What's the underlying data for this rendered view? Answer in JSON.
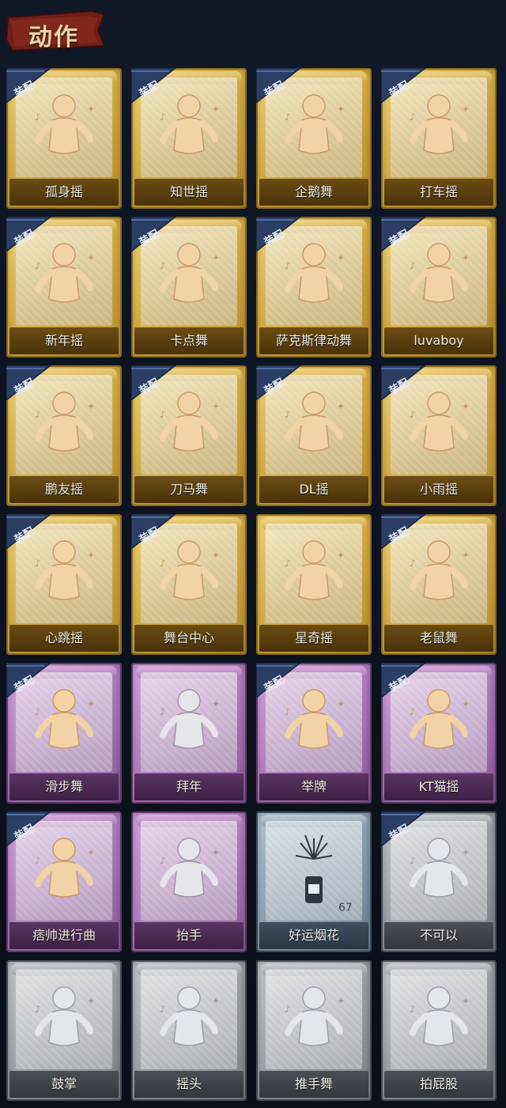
{
  "header": {
    "title": "动作"
  },
  "badge_label": "装配",
  "cards": [
    {
      "label": "孤身摇",
      "tier": "gold",
      "equipped": true,
      "count": ""
    },
    {
      "label": "知世摇",
      "tier": "gold",
      "equipped": true,
      "count": ""
    },
    {
      "label": "企鹅舞",
      "tier": "gold",
      "equipped": true,
      "count": ""
    },
    {
      "label": "打车摇",
      "tier": "gold",
      "equipped": true,
      "count": ""
    },
    {
      "label": "新年摇",
      "tier": "gold",
      "equipped": true,
      "count": ""
    },
    {
      "label": "卡点舞",
      "tier": "gold",
      "equipped": true,
      "count": ""
    },
    {
      "label": "萨克斯律动舞",
      "tier": "gold",
      "equipped": true,
      "count": ""
    },
    {
      "label": "luvaboy",
      "tier": "gold",
      "equipped": true,
      "count": ""
    },
    {
      "label": "鹏友摇",
      "tier": "gold",
      "equipped": true,
      "count": ""
    },
    {
      "label": "刀马舞",
      "tier": "gold",
      "equipped": true,
      "count": ""
    },
    {
      "label": "DL摇",
      "tier": "gold",
      "equipped": true,
      "count": ""
    },
    {
      "label": "小雨摇",
      "tier": "gold",
      "equipped": true,
      "count": ""
    },
    {
      "label": "心跳摇",
      "tier": "gold",
      "equipped": true,
      "count": ""
    },
    {
      "label": "舞台中心",
      "tier": "gold",
      "equipped": true,
      "count": ""
    },
    {
      "label": "星奇摇",
      "tier": "gold",
      "equipped": false,
      "count": ""
    },
    {
      "label": "老鼠舞",
      "tier": "gold",
      "equipped": true,
      "count": ""
    },
    {
      "label": "滑步舞",
      "tier": "purple",
      "equipped": true,
      "count": ""
    },
    {
      "label": "拜年",
      "tier": "purple",
      "equipped": false,
      "count": ""
    },
    {
      "label": "举牌",
      "tier": "purple",
      "equipped": true,
      "count": ""
    },
    {
      "label": "KT猫摇",
      "tier": "purple",
      "equipped": true,
      "count": ""
    },
    {
      "label": "痞帅进行曲",
      "tier": "purple",
      "equipped": true,
      "count": ""
    },
    {
      "label": "抬手",
      "tier": "purple",
      "equipped": false,
      "count": ""
    },
    {
      "label": "好运烟花",
      "tier": "blue",
      "equipped": false,
      "count": "67"
    },
    {
      "label": "不可以",
      "tier": "gray",
      "equipped": true,
      "count": ""
    },
    {
      "label": "鼓掌",
      "tier": "gray",
      "equipped": false,
      "count": ""
    },
    {
      "label": "摇头",
      "tier": "gray",
      "equipped": false,
      "count": ""
    },
    {
      "label": "推手舞",
      "tier": "gray",
      "equipped": false,
      "count": ""
    },
    {
      "label": "拍屁股",
      "tier": "gray",
      "equipped": false,
      "count": ""
    }
  ],
  "colors": {
    "gold": "#d7b04a",
    "purple": "#b27fbf",
    "blue": "#8fa2b4",
    "gray": "#9da3a9",
    "badge": "#2b3e63",
    "background": "#0e1522"
  }
}
